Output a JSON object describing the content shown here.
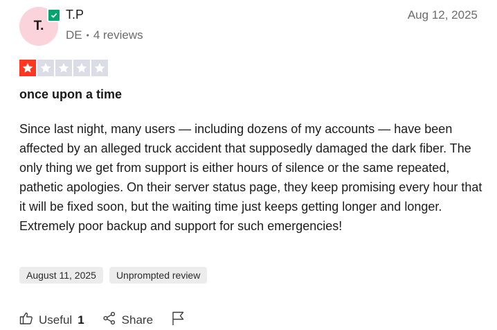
{
  "reviewer": {
    "initials": "T.",
    "name": "T.P",
    "country": "DE",
    "reviews_count": "4 reviews",
    "verified_icon": "verified-check-icon"
  },
  "review": {
    "date": "Aug 12, 2025",
    "rating": 1,
    "rating_max": 5,
    "title": "once upon a time",
    "body": "Since last night, many users — including dozens of my accounts — have been affected by an alleged truck accident that supposedly damaged the dark fiber. The only thing we get from support is either hours of silence or the same repeated, pathetic apologies. On their server status page, they keep promising every hour that it will be fixed soon, but the waiting time just keeps getting longer and longer. Extremely poor backup and support for such emergencies!",
    "experience_date": "August 11, 2025",
    "review_type": "Unprompted review"
  },
  "actions": {
    "useful_label": "Useful",
    "useful_count": "1",
    "share_label": "Share"
  },
  "colors": {
    "star_filled": "#ff3722",
    "star_empty": "#dcdce6",
    "avatar_bg": "#fbd3da",
    "verified": "#04a56c"
  }
}
